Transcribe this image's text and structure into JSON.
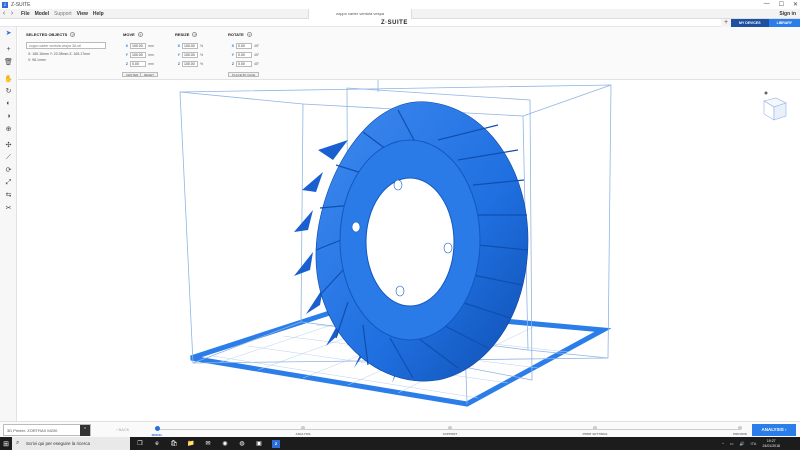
{
  "window": {
    "title": "Z-SUITE",
    "controls": [
      "—",
      "☐",
      "✕"
    ]
  },
  "menu": {
    "items": [
      "File",
      "Model",
      "Support",
      "View",
      "Help"
    ],
    "file_tab": "zoppo carter ventola vespa",
    "sign_in": "Sign in"
  },
  "brand": "Z·SUITE",
  "devices": {
    "add": "+",
    "my_devices": "MY DEVICES",
    "library": "LIBRARY"
  },
  "toolbar": {
    "tools": [
      {
        "icon": "pointer-icon",
        "glyph": "➤",
        "active": true
      },
      {
        "icon": "add-icon",
        "glyph": "+"
      },
      {
        "icon": "trash-icon",
        "glyph": "🗑"
      },
      {
        "icon": "hand-icon",
        "glyph": "✋"
      },
      {
        "icon": "rotate-view-icon",
        "glyph": "↻"
      },
      {
        "icon": "shade-icon",
        "glyph": "◐"
      },
      {
        "icon": "lens-icon",
        "glyph": "◑"
      },
      {
        "icon": "zoom-icon",
        "glyph": "⊕"
      },
      {
        "icon": "move-axes-icon",
        "glyph": "✣"
      },
      {
        "icon": "measure-icon",
        "glyph": "⟋"
      },
      {
        "icon": "rotate-object-icon",
        "glyph": "⟳"
      },
      {
        "icon": "scale-icon",
        "glyph": "⤢"
      },
      {
        "icon": "mirror-icon",
        "glyph": "⇆"
      },
      {
        "icon": "cut-icon",
        "glyph": "✂"
      }
    ]
  },
  "props": {
    "selected": {
      "title": "SELECTED OBJECTS",
      "file": "zoppo carter ventola vespa 3A.stl",
      "dims": "X: 165.15mm   Y: 20.38mm   Z: 165.17mm",
      "volume": "V: 98.1mm³"
    },
    "move": {
      "title": "MOVE",
      "fields": [
        {
          "axis": "X",
          "value": "100.00",
          "unit": "mm"
        },
        {
          "axis": "Y",
          "value": "100.00",
          "unit": "mm"
        },
        {
          "axis": "Z",
          "value": "0.00",
          "unit": "mm"
        }
      ],
      "buttons": [
        "CENTER",
        "RESET"
      ]
    },
    "resize": {
      "title": "RESIZE",
      "fields": [
        {
          "axis": "X",
          "value": "100.00",
          "unit": "%"
        },
        {
          "axis": "Y",
          "value": "100.00",
          "unit": "%"
        },
        {
          "axis": "Z",
          "value": "100.00",
          "unit": "%"
        }
      ]
    },
    "rotate": {
      "title": "ROTATE",
      "fields": [
        {
          "axis": "X",
          "value": "0.00",
          "unit": "45°"
        },
        {
          "axis": "Y",
          "value": "0.00",
          "unit": "45°"
        },
        {
          "axis": "Z",
          "value": "0.00",
          "unit": "45°"
        }
      ],
      "buttons": [
        "PLACE BY FACE"
      ]
    }
  },
  "workflow": {
    "printer_label": "3D Printer",
    "printer": "ZORTRAX M200",
    "back": "‹  BACK",
    "steps": [
      "MODEL",
      "ANALYSIS",
      "SUPPORT",
      "PRINT SETTINGS",
      "PREVIEW"
    ],
    "active_step": 0,
    "analyse": "ANALYSIS  ›"
  },
  "taskbar": {
    "search": "Scrivi qui per eseguire la ricerca",
    "icons": [
      {
        "name": "task-view-icon",
        "glyph": "❐"
      },
      {
        "name": "edge-icon",
        "glyph": "e"
      },
      {
        "name": "store-icon",
        "glyph": "🛍"
      },
      {
        "name": "files-icon",
        "glyph": "📁"
      },
      {
        "name": "mail-icon",
        "glyph": "✉"
      },
      {
        "name": "media-icon",
        "glyph": "◉"
      },
      {
        "name": "chrome-icon",
        "glyph": "◍"
      },
      {
        "name": "gallery-icon",
        "glyph": "▣"
      },
      {
        "name": "zsuite-icon",
        "glyph": "Z"
      }
    ],
    "tray": [
      "^",
      "▭",
      "🔊",
      "ITA"
    ],
    "time": "19:27",
    "date": "24/01/2018"
  },
  "colors": {
    "accent": "#2b6fd6",
    "model": "#1f6fe0",
    "cage": "#8fb4e3"
  }
}
